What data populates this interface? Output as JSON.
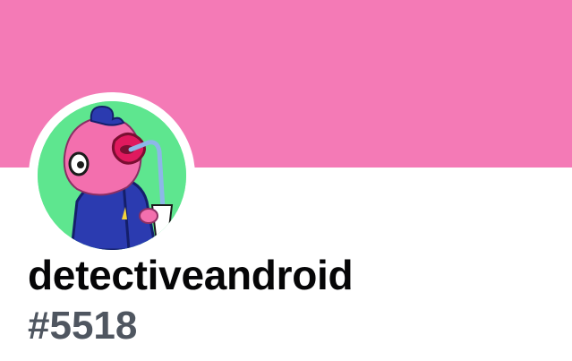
{
  "profile": {
    "username": "detectiveandroid",
    "discriminator": "#5518",
    "banner_color": "#f47ab6",
    "avatar": {
      "icon": "pink-bird-character-avatar",
      "background_color": "#5ee68f"
    }
  }
}
